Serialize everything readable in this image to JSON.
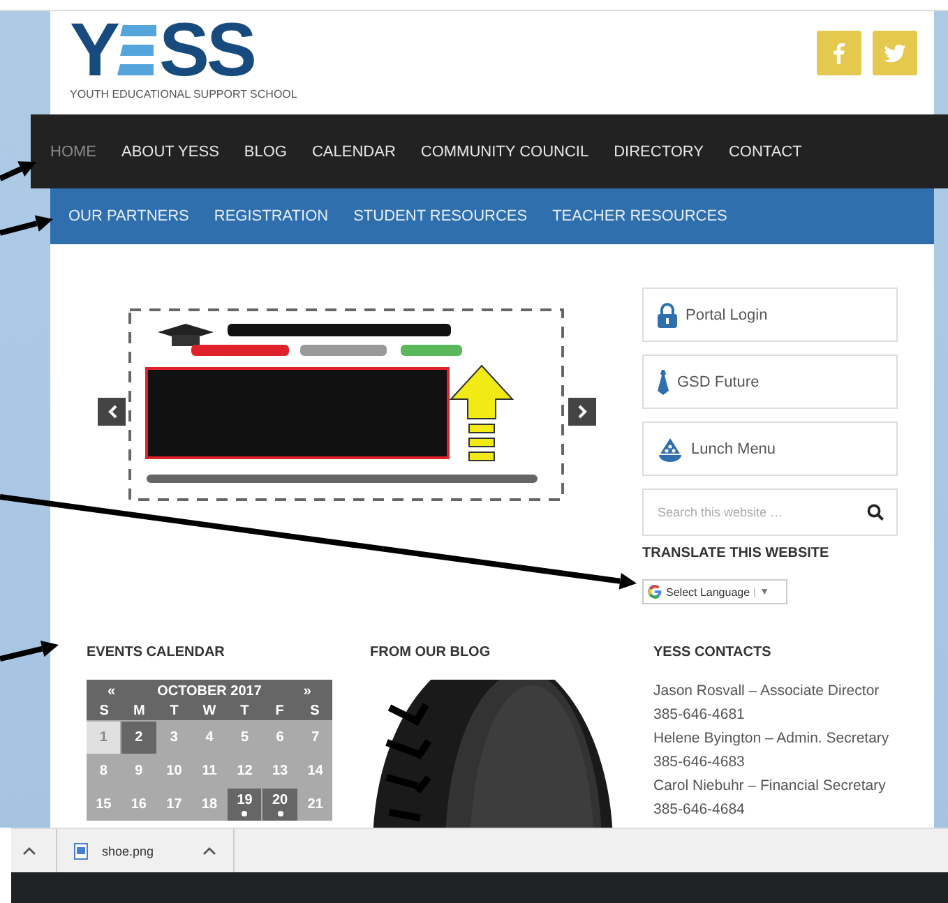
{
  "header": {
    "logo_left": "Y",
    "logo_right": "SS",
    "tagline": "YOUTH EDUCATIONAL SUPPORT SCHOOL"
  },
  "main_nav": [
    {
      "label": "HOME",
      "selected": true
    },
    {
      "label": "ABOUT YESS",
      "selected": false
    },
    {
      "label": "BLOG",
      "selected": false
    },
    {
      "label": "CALENDAR",
      "selected": false
    },
    {
      "label": "COMMUNITY COUNCIL",
      "selected": false
    },
    {
      "label": "DIRECTORY",
      "selected": false
    },
    {
      "label": "CONTACT",
      "selected": false
    }
  ],
  "sub_nav": [
    "OUR PARTNERS",
    "REGISTRATION",
    "STUDENT RESOURCES",
    "TEACHER RESOURCES"
  ],
  "sidebar": {
    "links": [
      {
        "label": "Portal Login",
        "kind": "lock"
      },
      {
        "label": "GSD Future",
        "kind": "tie"
      },
      {
        "label": "Lunch Menu",
        "kind": "dish"
      }
    ],
    "search": {
      "placeholder": "Search this website …"
    },
    "translate_title": "TRANSLATE THIS WEBSITE",
    "language_select": "Select Language",
    "select_arrow": "▼"
  },
  "calendar": {
    "title": "EVENTS CALENDAR",
    "prev": "«",
    "month": "OCTOBER 2017",
    "next": "»",
    "weekdays": [
      "S",
      "M",
      "T",
      "W",
      "T",
      "F",
      "S"
    ],
    "weeks": [
      [
        {
          "day": "1",
          "kind": "muted",
          "event": false
        },
        {
          "day": "2",
          "kind": "dark",
          "event": false
        },
        {
          "day": "3",
          "kind": "plain",
          "event": false
        },
        {
          "day": "4",
          "kind": "plain",
          "event": false
        },
        {
          "day": "5",
          "kind": "plain",
          "event": false
        },
        {
          "day": "6",
          "kind": "plain",
          "event": false
        },
        {
          "day": "7",
          "kind": "plain",
          "event": false
        }
      ],
      [
        {
          "day": "8",
          "kind": "plain",
          "event": false
        },
        {
          "day": "9",
          "kind": "plain",
          "event": false
        },
        {
          "day": "10",
          "kind": "plain",
          "event": false
        },
        {
          "day": "11",
          "kind": "plain",
          "event": false
        },
        {
          "day": "12",
          "kind": "plain",
          "event": false
        },
        {
          "day": "13",
          "kind": "plain",
          "event": false
        },
        {
          "day": "14",
          "kind": "plain",
          "event": false
        }
      ],
      [
        {
          "day": "15",
          "kind": "plain",
          "event": false
        },
        {
          "day": "16",
          "kind": "plain",
          "event": false
        },
        {
          "day": "17",
          "kind": "plain",
          "event": false
        },
        {
          "day": "18",
          "kind": "plain",
          "event": false
        },
        {
          "day": "19",
          "kind": "dark",
          "event": true
        },
        {
          "day": "20",
          "kind": "dark",
          "event": true
        },
        {
          "day": "21",
          "kind": "plain",
          "event": false
        }
      ]
    ]
  },
  "blog": {
    "title": "FROM OUR BLOG"
  },
  "contacts": {
    "title": "YESS CONTACTS",
    "lines": [
      "Jason Rosvall – Associate Director",
      "385-646-4681",
      "Helene Byington – Admin. Secretary",
      "385-646-4683",
      "Carol Niebuhr – Financial Secretary",
      "385-646-4684"
    ]
  },
  "download_bar": {
    "file": "shoe.png"
  }
}
